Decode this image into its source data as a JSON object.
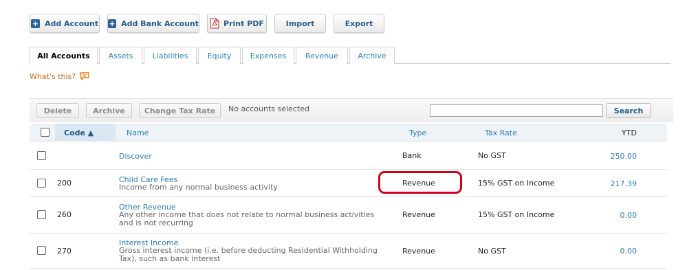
{
  "toolbar": {
    "add_account": "Add Account",
    "add_bank_account": "Add Bank Account",
    "print_pdf": "Print PDF",
    "import": "Import",
    "export": "Export"
  },
  "tabs": [
    {
      "label": "All Accounts",
      "active": true
    },
    {
      "label": "Assets"
    },
    {
      "label": "Liabilities"
    },
    {
      "label": "Equity"
    },
    {
      "label": "Expenses"
    },
    {
      "label": "Revenue"
    },
    {
      "label": "Archive"
    }
  ],
  "whats_this": "What's this?",
  "actions": {
    "delete": "Delete",
    "archive": "Archive",
    "change_tax_rate": "Change Tax Rate",
    "selection_status": "No accounts selected",
    "search_value": "",
    "search_button": "Search"
  },
  "table": {
    "headers": {
      "code": "Code ▲",
      "name": "Name",
      "type": "Type",
      "tax_rate": "Tax Rate",
      "ytd": "YTD"
    },
    "rows": [
      {
        "code": "",
        "name": "Discover",
        "description": "",
        "type": "Bank",
        "tax_rate": "No GST",
        "ytd": "250.00"
      },
      {
        "code": "200",
        "name": "Child Care Fees",
        "description": "Income from any normal business activity",
        "type": "Revenue",
        "tax_rate": "15% GST on Income",
        "ytd": "217.39"
      },
      {
        "code": "260",
        "name": "Other Revenue",
        "description": "Any other income that does not relate to normal business activities and is not recurring",
        "type": "Revenue",
        "tax_rate": "15% GST on Income",
        "ytd": "0.00"
      },
      {
        "code": "270",
        "name": "Interest Income",
        "description": "Gross interest income (i.e. before deducting Residential Withholding Tax), such as bank interest",
        "type": "Revenue",
        "tax_rate": "No GST",
        "ytd": "0.00"
      }
    ]
  },
  "colors": {
    "link": "#2b7fb8",
    "highlight": "#d0021b",
    "whats_this": "#c86a0e"
  }
}
